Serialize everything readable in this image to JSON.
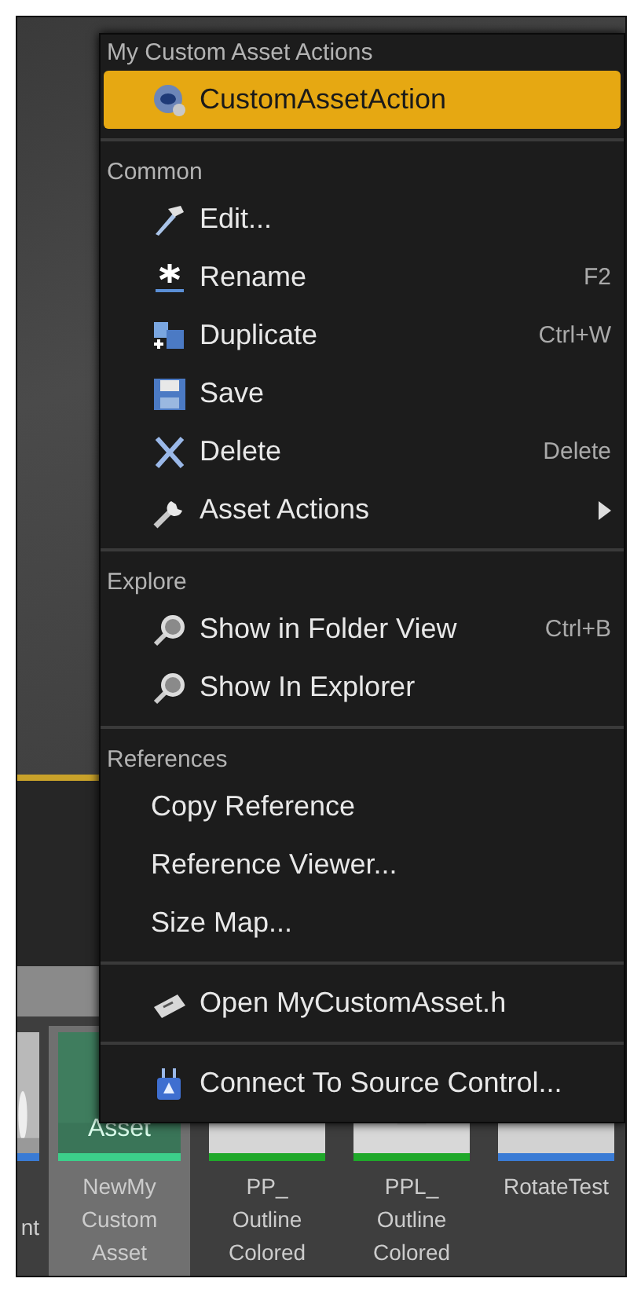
{
  "context_menu": {
    "sections": [
      {
        "heading": "My Custom Asset Actions",
        "items": [
          {
            "label": "CustomAssetAction",
            "selected": true,
            "submenu": false
          }
        ]
      },
      {
        "heading": "Common",
        "items": [
          {
            "label": "Edit...",
            "selected": false,
            "submenu": false
          },
          {
            "label": "Rename",
            "shortcut": "F2",
            "selected": false,
            "submenu": false
          },
          {
            "label": "Duplicate",
            "shortcut": "Ctrl+W",
            "selected": false,
            "submenu": false
          },
          {
            "label": "Save",
            "selected": false,
            "submenu": false
          },
          {
            "label": "Delete",
            "shortcut": "Delete",
            "selected": false,
            "submenu": false
          },
          {
            "label": "Asset Actions",
            "selected": false,
            "submenu": true
          }
        ]
      },
      {
        "heading": "Explore",
        "items": [
          {
            "label": "Show in Folder View",
            "shortcut": "Ctrl+B",
            "selected": false,
            "submenu": false
          },
          {
            "label": "Show In Explorer",
            "selected": false,
            "submenu": false
          }
        ]
      },
      {
        "heading": "References",
        "items": [
          {
            "label": "Copy Reference",
            "selected": false,
            "submenu": false
          },
          {
            "label": "Reference Viewer...",
            "selected": false,
            "submenu": false
          },
          {
            "label": "Size Map...",
            "selected": false,
            "submenu": false
          }
        ]
      },
      {
        "items": [
          {
            "label": "Open MyCustomAsset.h",
            "selected": false,
            "submenu": false
          }
        ]
      },
      {
        "items": [
          {
            "label": "Connect To Source Control...",
            "selected": false,
            "submenu": false
          }
        ]
      }
    ]
  },
  "assets": [
    {
      "label": "nt",
      "selected": false,
      "color": "#3a7bd5"
    },
    {
      "label": "NewMy Custom Asset",
      "thumbnail_text": "Asset",
      "selected": true,
      "color": "#3ccf8a"
    },
    {
      "label": "PP_ Outline Colored",
      "selected": false,
      "color": "#1fa82a"
    },
    {
      "label": "PPL_ Outline Colored",
      "selected": false,
      "color": "#1fa82a"
    },
    {
      "label": "RotateTest",
      "selected": false,
      "color": "#3a7bd5"
    }
  ]
}
